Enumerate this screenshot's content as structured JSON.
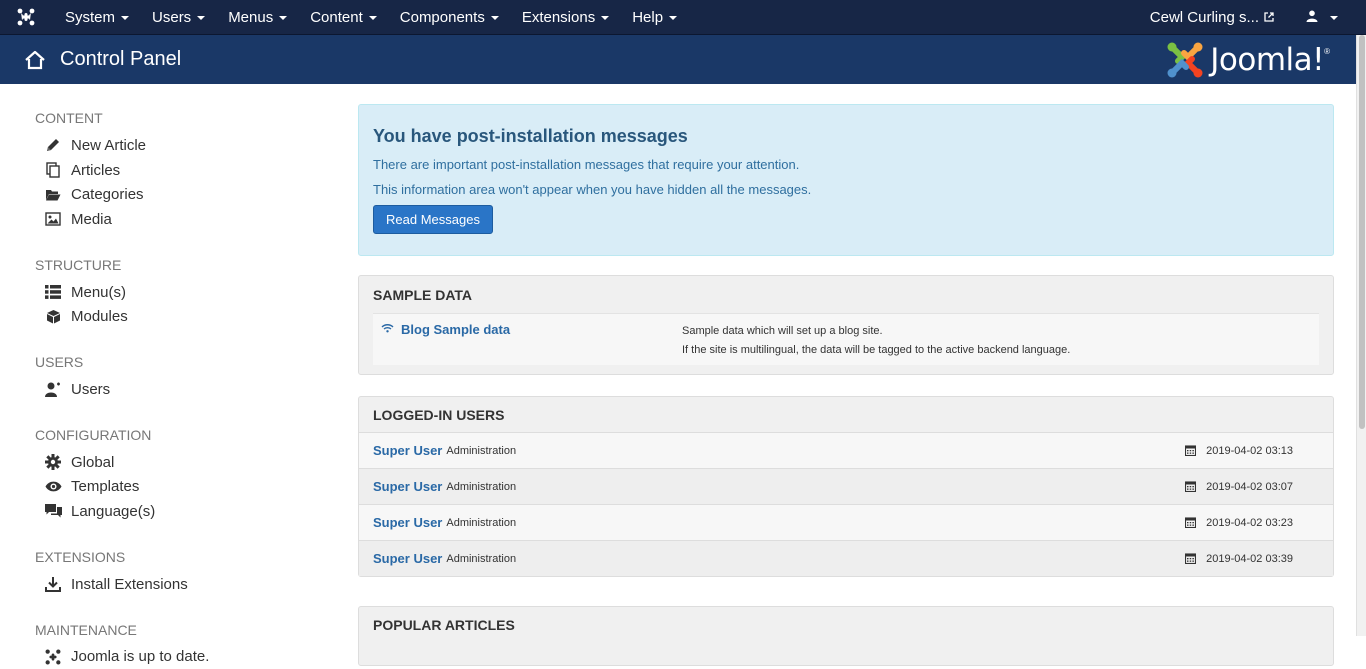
{
  "navbar": {
    "menu": [
      {
        "label": "System"
      },
      {
        "label": "Users"
      },
      {
        "label": "Menus"
      },
      {
        "label": "Content"
      },
      {
        "label": "Components"
      },
      {
        "label": "Extensions"
      },
      {
        "label": "Help"
      }
    ],
    "site_name": "Cewl Curling s...",
    "colors": {
      "navbar": "#172646",
      "header": "#1a3867"
    }
  },
  "header": {
    "title": "Control Panel",
    "brand": "Joomla!"
  },
  "sidebar": {
    "sections": [
      {
        "heading": "CONTENT",
        "items": [
          {
            "label": "New Article",
            "icon": "pencil-icon"
          },
          {
            "label": "Articles",
            "icon": "copy-icon"
          },
          {
            "label": "Categories",
            "icon": "folder-open-icon"
          },
          {
            "label": "Media",
            "icon": "image-icon"
          }
        ]
      },
      {
        "heading": "STRUCTURE",
        "items": [
          {
            "label": "Menu(s)",
            "icon": "list-icon"
          },
          {
            "label": "Modules",
            "icon": "cube-icon"
          }
        ]
      },
      {
        "heading": "USERS",
        "items": [
          {
            "label": "Users",
            "icon": "user-icon"
          }
        ]
      },
      {
        "heading": "CONFIGURATION",
        "items": [
          {
            "label": "Global",
            "icon": "cog-icon"
          },
          {
            "label": "Templates",
            "icon": "eye-icon"
          },
          {
            "label": "Language(s)",
            "icon": "comments-icon"
          }
        ]
      },
      {
        "heading": "EXTENSIONS",
        "items": [
          {
            "label": "Install Extensions",
            "icon": "download-icon"
          }
        ]
      },
      {
        "heading": "MAINTENANCE",
        "items": [
          {
            "label": "Joomla is up to date.",
            "icon": "joomla-icon"
          }
        ]
      }
    ]
  },
  "postinstall": {
    "title": "You have post-installation messages",
    "line1": "There are important post-installation messages that require your attention.",
    "line2": "This information area won't appear when you have hidden all the messages.",
    "button": "Read Messages"
  },
  "sample_data": {
    "heading": "SAMPLE DATA",
    "item": {
      "name": "Blog Sample data",
      "icon": "wifi-icon",
      "desc1": "Sample data which will set up a blog site.",
      "desc2": "If the site is multilingual, the data will be tagged to the active backend language."
    }
  },
  "logged_in": {
    "heading": "LOGGED-IN USERS",
    "rows": [
      {
        "name": "Super User",
        "client": "Administration",
        "date": "2019-04-02 03:13"
      },
      {
        "name": "Super User",
        "client": "Administration",
        "date": "2019-04-02 03:07"
      },
      {
        "name": "Super User",
        "client": "Administration",
        "date": "2019-04-02 03:23"
      },
      {
        "name": "Super User",
        "client": "Administration",
        "date": "2019-04-02 03:39"
      }
    ]
  },
  "popular": {
    "heading": "POPULAR ARTICLES"
  }
}
